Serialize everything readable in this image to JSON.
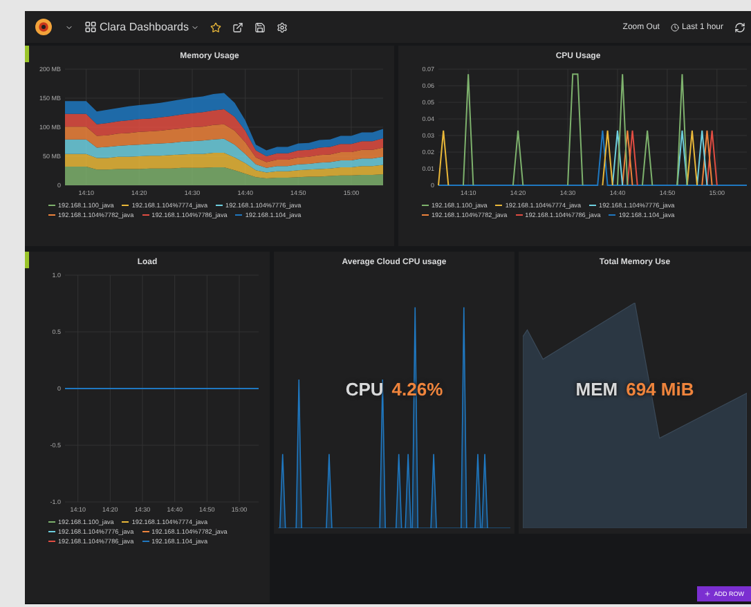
{
  "topbar": {
    "dashboard_title": "Clara Dashboards",
    "zoom_out": "Zoom Out",
    "time_range": "Last 1 hour"
  },
  "panels": [
    {
      "kind": "graph",
      "title": "Memory Usage",
      "chart_data": {
        "type": "area",
        "stacked": true,
        "grid": true,
        "categories": [
          null,
          null,
          "14:10",
          null,
          null,
          null,
          null,
          "14:20",
          null,
          null,
          null,
          null,
          "14:30",
          null,
          null,
          null,
          null,
          "14:40",
          null,
          null,
          null,
          null,
          "14:50",
          null,
          null,
          null,
          null,
          "15:00",
          null,
          null,
          null
        ],
        "ylim": [
          0,
          200
        ],
        "yticks": [
          {
            "value": 0,
            "label": "0"
          },
          {
            "value": 50,
            "label": "50 MB"
          },
          {
            "value": 100,
            "label": "100 MB"
          },
          {
            "value": 150,
            "label": "150 MB"
          },
          {
            "value": 200,
            "label": "200 MB"
          }
        ],
        "series": [
          {
            "name": "192.168.1.100_java",
            "color": "#7eb26d",
            "values": [
              32,
              32,
              32,
              27,
              27,
              28,
              28,
              28,
              29,
              29,
              29,
              30,
              30,
              30,
              31,
              31,
              26,
              20,
              14,
              12,
              13,
              13,
              14,
              15,
              15,
              16,
              17,
              17,
              18,
              18,
              19
            ]
          },
          {
            "name": "192.168.1.104%7774_java",
            "color": "#eab839",
            "values": [
              22,
              22,
              22,
              20,
              20,
              21,
              21,
              22,
              22,
              22,
              23,
              23,
              24,
              24,
              25,
              25,
              22,
              18,
              12,
              10,
              11,
              11,
              12,
              12,
              13,
              13,
              14,
              14,
              15,
              15,
              16
            ]
          },
          {
            "name": "192.168.1.104%7776_java",
            "color": "#6ed0e0",
            "values": [
              25,
              25,
              25,
              18,
              19,
              19,
              20,
              20,
              20,
              21,
              21,
              22,
              22,
              23,
              23,
              24,
              22,
              16,
              10,
              8,
              9,
              9,
              10,
              10,
              11,
              11,
              12,
              12,
              13,
              13,
              14
            ]
          },
          {
            "name": "192.168.1.104%7782_java",
            "color": "#ef843c",
            "values": [
              22,
              22,
              22,
              20,
              20,
              21,
              21,
              22,
              22,
              22,
              23,
              23,
              24,
              24,
              25,
              25,
              24,
              20,
              12,
              10,
              11,
              11,
              12,
              12,
              13,
              13,
              14,
              14,
              15,
              15,
              16
            ]
          },
          {
            "name": "192.168.1.104%7786_java",
            "color": "#e24d42",
            "values": [
              22,
              22,
              22,
              20,
              21,
              21,
              22,
              22,
              22,
              23,
              23,
              24,
              24,
              25,
              25,
              26,
              24,
              20,
              12,
              10,
              11,
              11,
              12,
              12,
              13,
              13,
              14,
              14,
              15,
              15,
              16
            ]
          },
          {
            "name": "192.168.1.104_java",
            "color": "#1f78c1",
            "values": [
              22,
              22,
              22,
              22,
              23,
              23,
              24,
              24,
              25,
              25,
              26,
              26,
              27,
              27,
              28,
              28,
              24,
              18,
              10,
              10,
              11,
              11,
              12,
              12,
              13,
              13,
              14,
              14,
              15,
              15,
              16
            ]
          }
        ]
      }
    },
    {
      "kind": "graph",
      "title": "CPU Usage",
      "chart_data": {
        "type": "line",
        "grid": true,
        "categories": [
          null,
          null,
          null,
          null,
          null,
          null,
          "14:10",
          null,
          null,
          null,
          null,
          null,
          null,
          null,
          null,
          null,
          "14:20",
          null,
          null,
          null,
          null,
          null,
          null,
          null,
          null,
          null,
          "14:30",
          null,
          null,
          null,
          null,
          null,
          null,
          null,
          null,
          null,
          "14:40",
          null,
          null,
          null,
          null,
          null,
          null,
          null,
          null,
          null,
          "14:50",
          null,
          null,
          null,
          null,
          null,
          null,
          null,
          null,
          null,
          "15:00",
          null,
          null,
          null,
          null,
          null,
          null
        ],
        "ylim": [
          0,
          0.07
        ],
        "yticks": [
          0,
          0.01,
          0.02,
          0.03,
          0.04,
          0.05,
          0.06,
          0.07
        ],
        "series": [
          {
            "name": "192.168.1.100_java",
            "color": "#7eb26d",
            "values": [
              null,
              null,
              null,
              null,
              null,
              0,
              0.067,
              0,
              null,
              null,
              null,
              null,
              null,
              null,
              null,
              0,
              0.033,
              0,
              null,
              null,
              null,
              null,
              null,
              null,
              null,
              null,
              0,
              0.067,
              0.067,
              0,
              null,
              null,
              null,
              null,
              null,
              null,
              0,
              0.067,
              0,
              null,
              null,
              0,
              0.033,
              0,
              null,
              null,
              null,
              null,
              0,
              0.067,
              0,
              null,
              null,
              null,
              null,
              null,
              null,
              null,
              null,
              null,
              null,
              null,
              null
            ]
          },
          {
            "name": "192.168.1.104%7774_java",
            "color": "#eab839",
            "values": [
              0,
              0.033,
              0,
              null,
              null,
              null,
              null,
              null,
              null,
              null,
              null,
              null,
              null,
              null,
              null,
              null,
              null,
              null,
              null,
              null,
              null,
              null,
              null,
              null,
              null,
              null,
              null,
              null,
              null,
              null,
              null,
              null,
              null,
              0,
              0.033,
              0,
              null,
              null,
              null,
              null,
              null,
              null,
              null,
              null,
              null,
              null,
              null,
              null,
              null,
              null,
              0,
              0.033,
              0,
              null,
              null,
              null,
              null,
              null,
              null,
              null,
              null,
              null,
              null
            ]
          },
          {
            "name": "192.168.1.104%7776_java",
            "color": "#6ed0e0",
            "values": [
              null,
              null,
              null,
              null,
              null,
              null,
              null,
              null,
              null,
              null,
              null,
              null,
              null,
              null,
              null,
              null,
              null,
              null,
              null,
              null,
              null,
              null,
              null,
              null,
              null,
              null,
              null,
              null,
              null,
              null,
              null,
              null,
              null,
              null,
              null,
              0,
              0.033,
              0,
              null,
              null,
              null,
              null,
              null,
              null,
              null,
              null,
              null,
              null,
              0,
              0.033,
              0,
              null,
              0,
              0.033,
              0,
              null,
              null,
              null,
              null,
              null,
              null,
              null,
              null
            ]
          },
          {
            "name": "192.168.1.104%7782_java",
            "color": "#ef843c",
            "values": [
              null,
              null,
              null,
              null,
              null,
              null,
              null,
              null,
              null,
              null,
              null,
              null,
              null,
              null,
              null,
              null,
              null,
              null,
              null,
              null,
              null,
              null,
              null,
              null,
              null,
              null,
              null,
              null,
              null,
              null,
              null,
              null,
              null,
              null,
              null,
              null,
              null,
              0,
              0.033,
              0,
              null,
              null,
              null,
              null,
              null,
              null,
              null,
              null,
              null,
              null,
              null,
              null,
              null,
              0,
              0.033,
              0,
              null,
              null,
              null,
              null,
              null,
              null,
              null
            ]
          },
          {
            "name": "192.168.1.104%7786_java",
            "color": "#e24d42",
            "values": [
              null,
              null,
              null,
              null,
              null,
              null,
              null,
              null,
              null,
              null,
              null,
              null,
              null,
              null,
              null,
              null,
              null,
              null,
              null,
              null,
              null,
              null,
              null,
              null,
              null,
              null,
              null,
              null,
              null,
              null,
              null,
              null,
              null,
              null,
              null,
              null,
              null,
              null,
              0,
              0.033,
              0,
              null,
              null,
              null,
              null,
              null,
              null,
              null,
              null,
              null,
              null,
              null,
              null,
              null,
              0,
              0.033,
              0,
              null,
              null,
              null,
              null,
              null,
              null
            ]
          },
          {
            "name": "192.168.1.104_java",
            "color": "#1f78c1",
            "values": [
              0,
              0,
              0,
              0,
              0,
              0,
              0,
              0,
              0,
              0,
              0,
              0,
              0,
              0,
              0,
              0,
              0,
              0,
              0,
              0,
              0,
              0,
              0,
              0,
              0,
              0,
              0,
              0,
              0,
              0,
              0,
              0,
              0,
              0.033,
              0,
              0,
              0,
              0,
              0,
              0,
              0,
              0,
              0,
              0,
              0,
              0,
              0,
              0,
              0,
              0,
              0,
              0,
              0,
              0,
              0,
              0,
              0,
              0,
              0,
              0,
              0,
              0,
              0
            ]
          }
        ]
      }
    },
    {
      "kind": "graph",
      "title": "Load",
      "chart_data": {
        "type": "line",
        "grid": true,
        "categories": [
          null,
          null,
          "14:10",
          null,
          null,
          null,
          null,
          "14:20",
          null,
          null,
          null,
          null,
          "14:30",
          null,
          null,
          null,
          null,
          "14:40",
          null,
          null,
          null,
          null,
          "14:50",
          null,
          null,
          null,
          null,
          "15:00",
          null,
          null,
          null
        ],
        "ylim": [
          -1,
          1
        ],
        "yticks": [
          {
            "value": -1,
            "label": "-1.0"
          },
          {
            "value": -0.5,
            "label": "-0.5"
          },
          {
            "value": 0,
            "label": "0"
          },
          {
            "value": 0.5,
            "label": "0.5"
          },
          {
            "value": 1,
            "label": "1.0"
          }
        ],
        "series": [
          {
            "name": "192.168.1.100_java",
            "color": "#7eb26d",
            "values": [
              null,
              null,
              null,
              null,
              null,
              null,
              null,
              null,
              null,
              null,
              null,
              null,
              null,
              null,
              null,
              null,
              null,
              null,
              null,
              null,
              null,
              null,
              null,
              null,
              null,
              null,
              null,
              null,
              null,
              null,
              null
            ]
          },
          {
            "name": "192.168.1.104%7774_java",
            "color": "#eab839",
            "values": [
              null,
              null,
              null,
              null,
              null,
              null,
              null,
              null,
              null,
              null,
              null,
              null,
              null,
              null,
              null,
              null,
              null,
              null,
              null,
              null,
              null,
              null,
              null,
              null,
              null,
              null,
              null,
              null,
              null,
              null,
              null
            ]
          },
          {
            "name": "192.168.1.104%7776_java",
            "color": "#6ed0e0",
            "values": [
              null,
              null,
              null,
              null,
              null,
              null,
              null,
              null,
              null,
              null,
              null,
              null,
              null,
              null,
              null,
              null,
              null,
              null,
              null,
              null,
              null,
              null,
              null,
              null,
              null,
              null,
              null,
              null,
              null,
              null,
              null
            ]
          },
          {
            "name": "192.168.1.104%7782_java",
            "color": "#ef843c",
            "values": [
              null,
              null,
              null,
              null,
              null,
              null,
              null,
              null,
              null,
              null,
              null,
              null,
              null,
              null,
              null,
              null,
              null,
              null,
              null,
              null,
              null,
              null,
              null,
              null,
              null,
              null,
              null,
              null,
              null,
              null,
              null
            ]
          },
          {
            "name": "192.168.1.104%7786_java",
            "color": "#e24d42",
            "values": [
              null,
              null,
              null,
              null,
              null,
              null,
              null,
              null,
              null,
              null,
              null,
              null,
              null,
              null,
              null,
              null,
              null,
              null,
              null,
              null,
              null,
              null,
              null,
              null,
              null,
              null,
              null,
              null,
              null,
              null,
              null
            ]
          },
          {
            "name": "192.168.1.104_java",
            "color": "#1f78c1",
            "values": [
              0,
              0,
              0,
              0,
              0,
              0,
              0,
              0,
              0,
              0,
              0,
              0,
              0,
              0,
              0,
              0,
              0,
              0,
              0,
              0,
              0,
              0,
              0,
              0,
              0,
              0,
              0,
              0,
              0,
              0,
              0
            ]
          }
        ]
      }
    },
    {
      "kind": "spikestat",
      "title": "Average Cloud CPU usage",
      "prefix": "CPU",
      "value": "4.26%"
    },
    {
      "kind": "areastat",
      "title": "Total Memory Use",
      "prefix": "MEM",
      "value": "694 MiB"
    }
  ],
  "add_row_button": "ADD ROW"
}
